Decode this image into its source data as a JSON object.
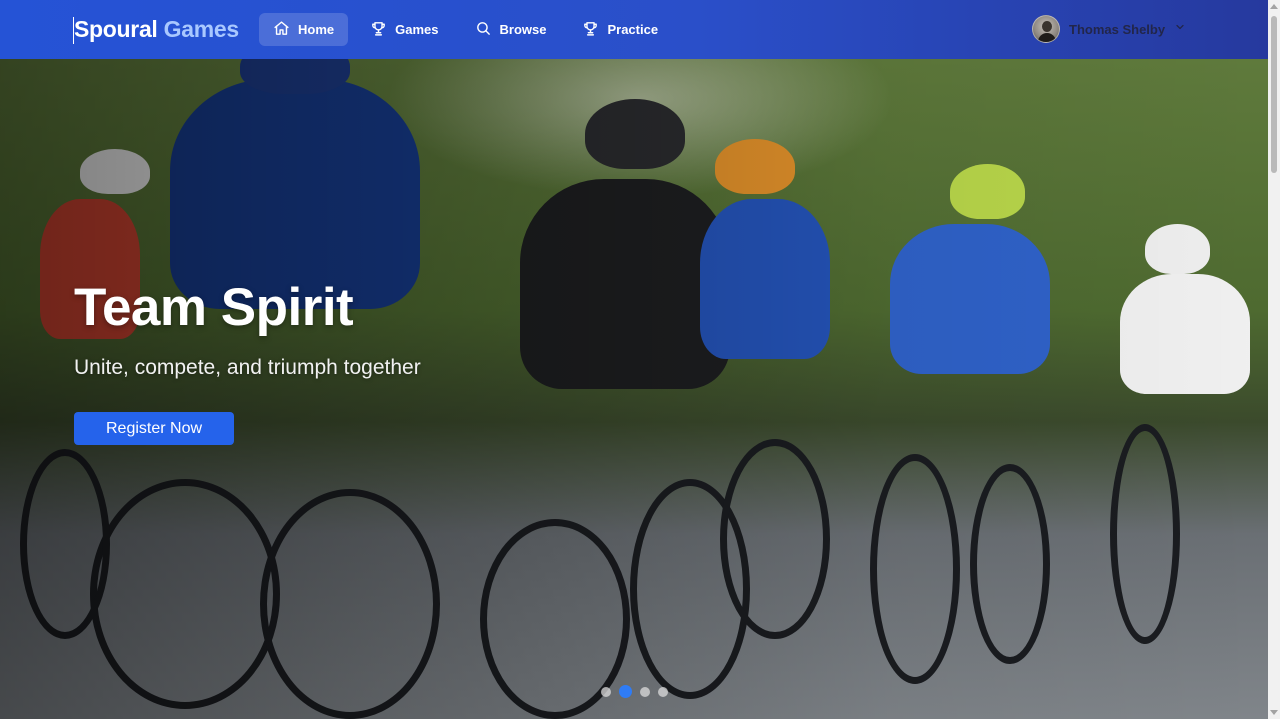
{
  "brand": {
    "part1": "Spoural",
    "part2": "Games"
  },
  "nav": {
    "items": [
      {
        "label": "Home",
        "icon": "home-icon",
        "active": true
      },
      {
        "label": "Games",
        "icon": "trophy-icon",
        "active": false
      },
      {
        "label": "Browse",
        "icon": "search-icon",
        "active": false
      },
      {
        "label": "Practice",
        "icon": "trophy-icon",
        "active": false
      }
    ]
  },
  "user": {
    "name": "Thomas Shelby",
    "avatar": "avatar",
    "menu_icon": "chevron-down-icon"
  },
  "hero": {
    "title": "Team Spirit",
    "subtitle": "Unite, compete, and triumph together",
    "cta_label": "Register Now",
    "image": "cyclists-racing-photo"
  },
  "carousel": {
    "slide_count": 4,
    "active_index": 1
  },
  "colors": {
    "nav_start": "#2553d6",
    "nav_end": "#26399e",
    "brand_accent": "#a9c8ff",
    "cta": "#2563eb",
    "dot_active": "#2f7cf6"
  }
}
